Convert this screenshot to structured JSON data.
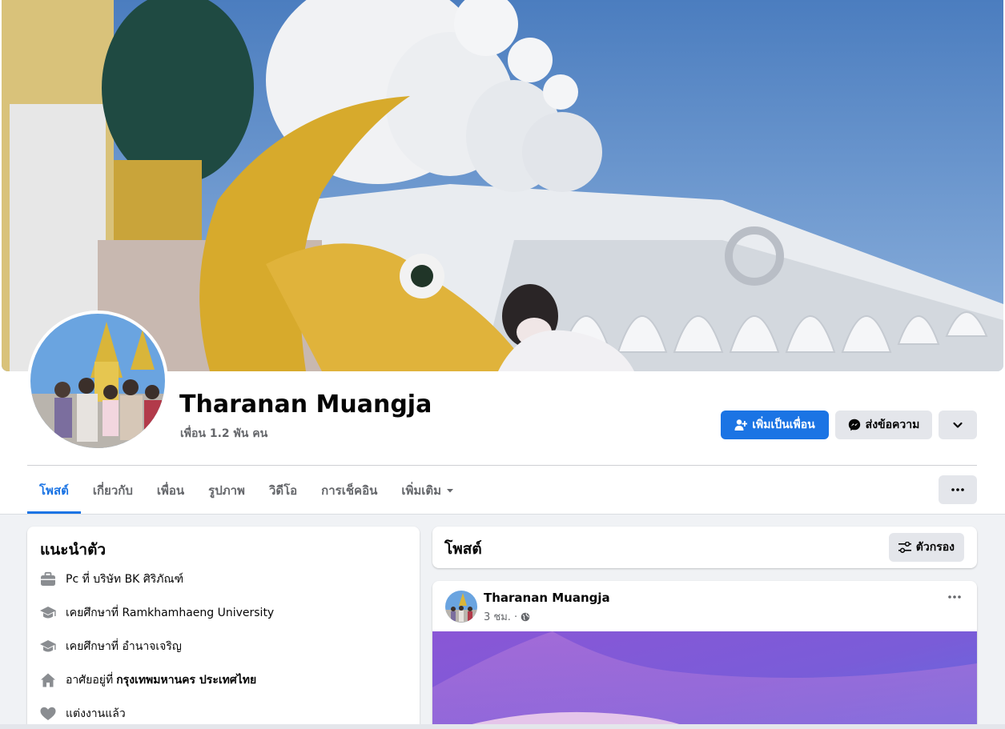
{
  "profile": {
    "name": "Tharanan Muangja",
    "friends": "เพื่อน 1.2 พัน คน"
  },
  "actions": {
    "add_friend": "เพิ่มเป็นเพื่อน",
    "message": "ส่งข้อความ"
  },
  "tabs": [
    {
      "label": "โพสต์",
      "active": true
    },
    {
      "label": "เกี่ยวกับ"
    },
    {
      "label": "เพื่อน"
    },
    {
      "label": "รูปภาพ"
    },
    {
      "label": "วิดีโอ"
    },
    {
      "label": "การเช็คอิน"
    },
    {
      "label": "เพิ่มเติม"
    }
  ],
  "intro": {
    "title": "แนะนำตัว",
    "items": [
      {
        "icon": "briefcase-icon",
        "text": "Pc ที่ บริษัท BK ศิริภัณฑ์",
        "bold": ""
      },
      {
        "icon": "graduation-cap-icon",
        "text": "เคยศึกษาที่ Ramkhamhaeng University",
        "bold": ""
      },
      {
        "icon": "graduation-cap-icon",
        "text": "เคยศึกษาที่ อำนาจเจริญ",
        "bold": ""
      },
      {
        "icon": "home-icon",
        "text": "อาศัยอยู่ที่",
        "bold": "กรุงเทพมหานคร ประเทศไทย"
      },
      {
        "icon": "heart-icon",
        "text": "แต่งงานแล้ว",
        "bold": ""
      }
    ]
  },
  "posts": {
    "title": "โพสต์",
    "filter_label": "ตัวกรอง"
  },
  "post": {
    "author": "Tharanan Muangja",
    "time": "3 ชม. ·",
    "privacy_icon": "globe-icon"
  },
  "colors": {
    "accent": "#1b74e4",
    "secondary_button": "#e4e6eb",
    "page_background": "#f0f2f5",
    "muted_text": "#65676b"
  }
}
